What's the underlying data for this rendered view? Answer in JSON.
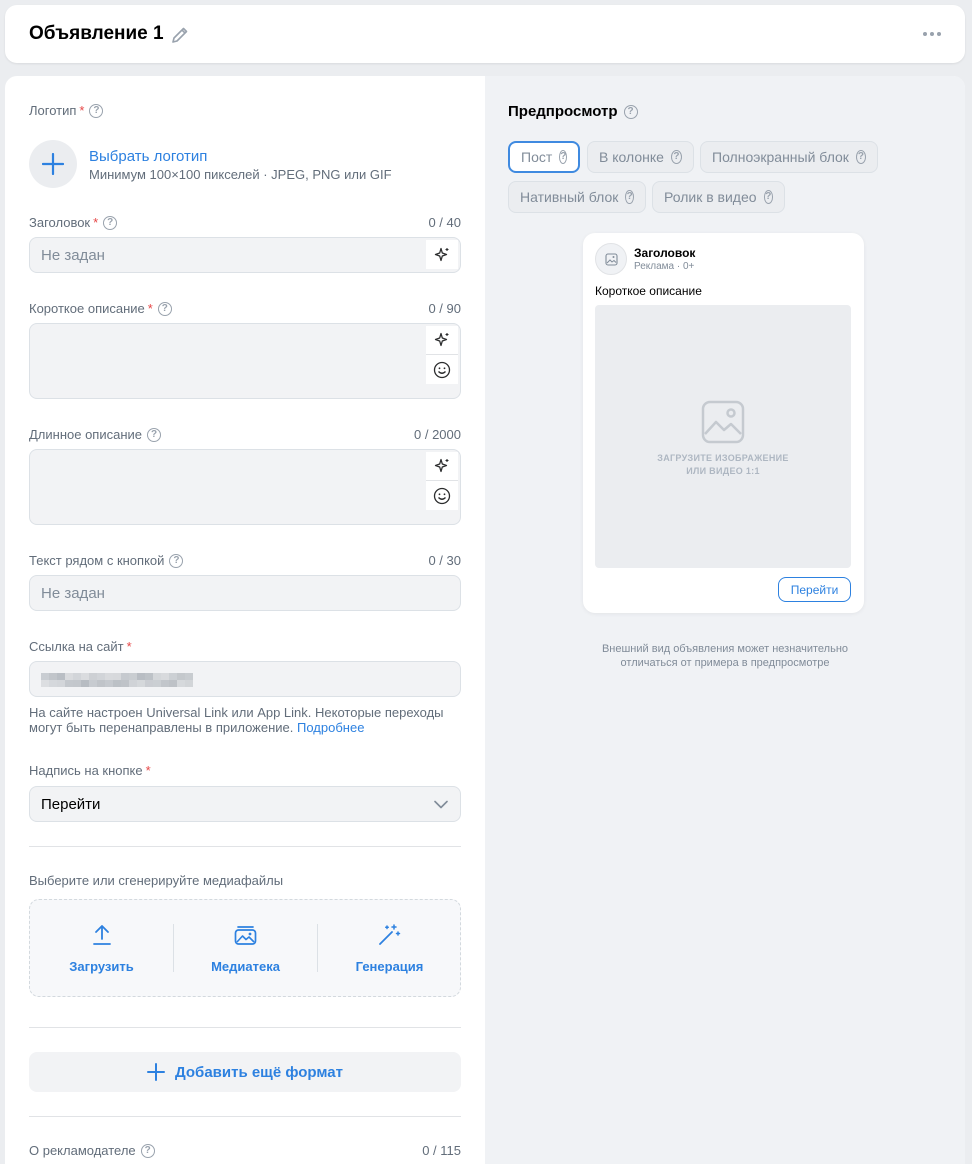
{
  "header": {
    "title": "Объявление 1"
  },
  "form": {
    "logo": {
      "label": "Логотип",
      "action": "Выбрать логотип",
      "hint": "Минимум 100×100 пикселей · JPEG, PNG или GIF"
    },
    "headline": {
      "label": "Заголовок",
      "counter": "0 / 40",
      "placeholder": "Не задан"
    },
    "short_desc": {
      "label": "Короткое описание",
      "counter": "0 / 90"
    },
    "long_desc": {
      "label": "Длинное описание",
      "counter": "0 / 2000"
    },
    "button_text": {
      "label": "Текст рядом с кнопкой",
      "counter": "0 / 30",
      "placeholder": "Не задан"
    },
    "site_link": {
      "label": "Ссылка на сайт",
      "hint_line1": "На сайте настроен Universal Link или App Link. Некоторые переходы",
      "hint_line2": "могут быть перенаправлены в приложение. ",
      "more": "Подробнее"
    },
    "cta": {
      "label": "Надпись на кнопке",
      "value": "Перейти"
    },
    "media": {
      "label": "Выберите или сгенерируйте медиафайлы",
      "upload": "Загрузить",
      "library": "Медиатека",
      "generate": "Генерация"
    },
    "add_format": "Добавить ещё формат",
    "advertiser": {
      "label": "О рекламодателе",
      "counter": "0 / 115"
    }
  },
  "preview": {
    "title": "Предпросмотр",
    "tabs": [
      "Пост",
      "В колонке",
      "Полноэкранный блок",
      "Нативный блок",
      "Ролик в видео"
    ],
    "active_tab": "Пост",
    "card": {
      "headline": "Заголовок",
      "meta": "Реклама · 0+",
      "description": "Короткое описание",
      "placeholder_line1": "ЗАГРУЗИТЕ ИЗОБРАЖЕНИЕ",
      "placeholder_line2": "ИЛИ ВИДЕО 1:1",
      "button": "Перейти"
    },
    "note_line1": "Внешний вид объявления может незначительно",
    "note_line2": "отличаться от примера в предпросмотре"
  },
  "colors": {
    "accent": "#2d81e0",
    "required": "#e64646",
    "page_bg": "#ebedf0"
  }
}
